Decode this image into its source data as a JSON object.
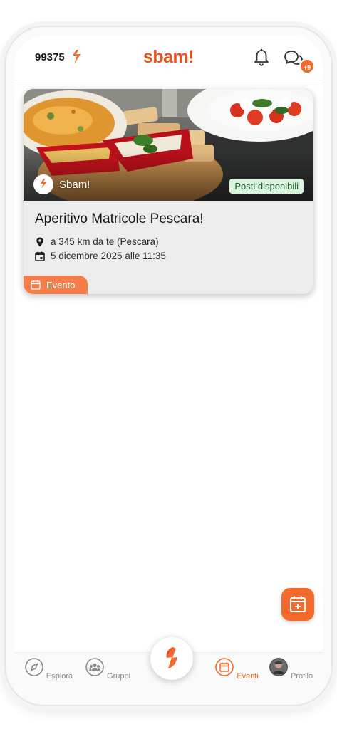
{
  "header": {
    "points": "99375",
    "brand": "sbam!",
    "chat_badge": "+9"
  },
  "event": {
    "organizer": "Sbam!",
    "availability": "Posti disponibili",
    "title": "Aperitivo Matricole Pescara!",
    "distance": "a 345 km da te (Pescara)",
    "date": "5 dicembre 2025 alle 11:35",
    "tag": "Evento"
  },
  "nav": {
    "items": [
      {
        "label": "Esplora",
        "icon": "compass-icon"
      },
      {
        "label": "Gruppi",
        "icon": "group-icon"
      },
      {
        "label": "",
        "icon": "sbam-bolt-icon"
      },
      {
        "label": "Eventi",
        "icon": "calendar-icon"
      },
      {
        "label": "Profilo",
        "icon": "avatar-icon"
      }
    ],
    "active": "Eventi"
  },
  "colors": {
    "brand": "#e8501f",
    "accent": "#f26a2e",
    "available_bg": "#d9f5dd"
  }
}
